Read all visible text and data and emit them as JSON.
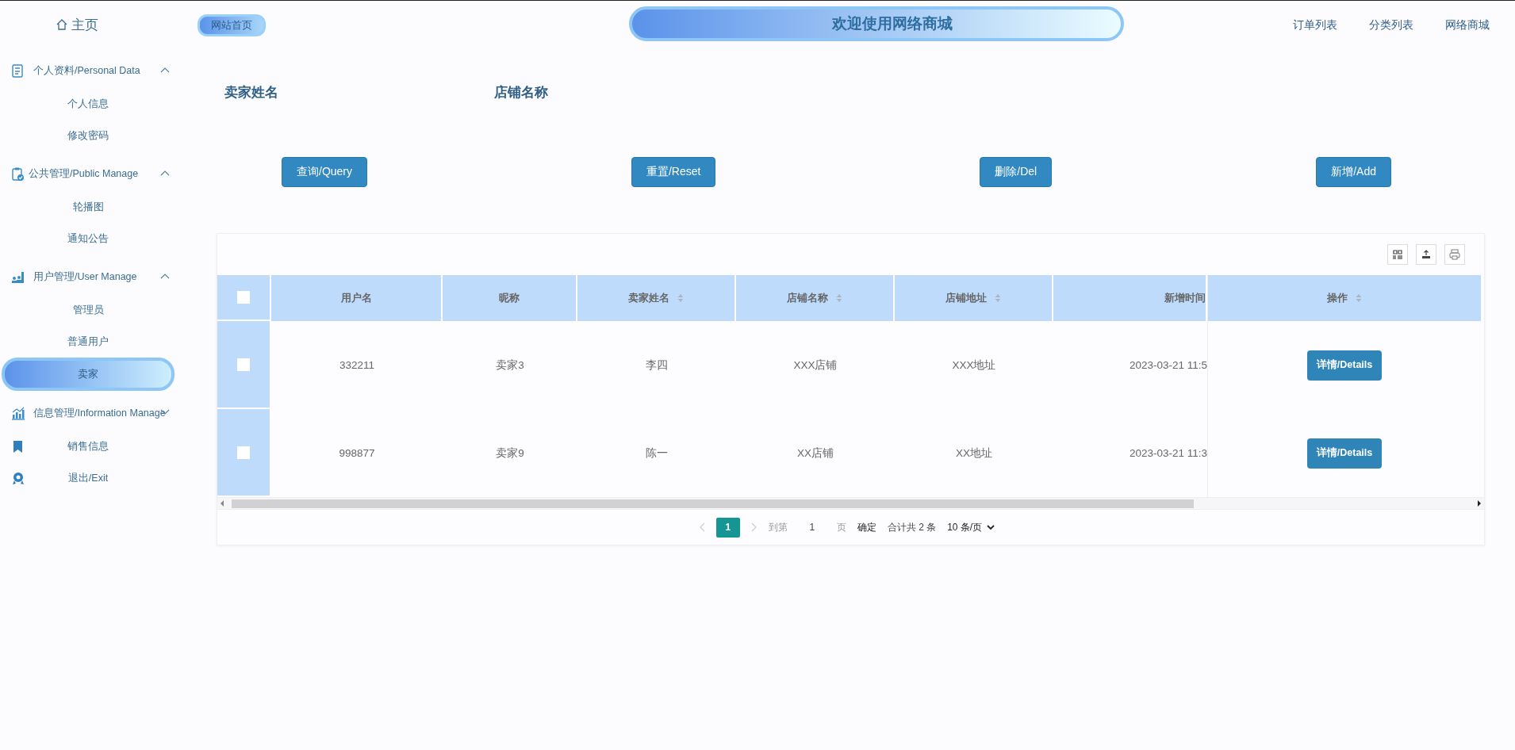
{
  "sidebar": {
    "home": "主页",
    "items": [
      {
        "kind": "group",
        "label": "个人资料/Personal Data",
        "expanded": true,
        "children": [
          {
            "label": "个人信息",
            "selected": false
          },
          {
            "label": "修改密码",
            "selected": false
          }
        ]
      },
      {
        "kind": "group",
        "label": "公共管理/Public Manage",
        "expanded": true,
        "children": [
          {
            "label": "轮播图",
            "selected": false
          },
          {
            "label": "通知公告",
            "selected": false
          }
        ]
      },
      {
        "kind": "group",
        "label": "用户管理/User Manage",
        "expanded": true,
        "children": [
          {
            "label": "管理员",
            "selected": false
          },
          {
            "label": "普通用户",
            "selected": false
          },
          {
            "label": "卖家",
            "selected": true
          }
        ]
      },
      {
        "kind": "group",
        "label": "信息管理/Information Manage",
        "expanded": false
      },
      {
        "kind": "item",
        "label": "销售信息"
      },
      {
        "kind": "item",
        "label": "退出/Exit"
      }
    ]
  },
  "header": {
    "home_link": "网站首页",
    "title": "欢迎使用网络商城",
    "nav": [
      "订单列表",
      "分类列表",
      "网络商城"
    ]
  },
  "search": {
    "fields": [
      "卖家姓名",
      "店铺名称"
    ]
  },
  "buttons": [
    "查询/Query",
    "重置/Reset",
    "删除/Del",
    "新增/Add"
  ],
  "table": {
    "select_all": false,
    "columns": [
      {
        "label": "用户名",
        "sortable": false
      },
      {
        "label": "昵称",
        "sortable": false
      },
      {
        "label": "卖家姓名",
        "sortable": true
      },
      {
        "label": "店铺名称",
        "sortable": true
      },
      {
        "label": "店铺地址",
        "sortable": true
      },
      {
        "label": "新增时间",
        "sortable": false
      },
      {
        "label": "操作",
        "sortable": true
      }
    ],
    "rows": [
      {
        "checked": false,
        "cells": [
          "332211",
          "卖家3",
          "李四",
          "XXX店铺",
          "XXX地址",
          "2023-03-21 11:5"
        ],
        "action": "详情/Details"
      },
      {
        "checked": false,
        "cells": [
          "998877",
          "卖家9",
          "陈一",
          "XX店铺",
          "XX地址",
          "2023-03-21 11:3"
        ],
        "action": "详情/Details"
      }
    ]
  },
  "pagination": {
    "pages": [
      {
        "label": "1",
        "selected": true
      }
    ],
    "goto_label": "到第",
    "goto_value": "1",
    "page_unit": "页",
    "confirm": "确定",
    "total": "合计共 2 条",
    "page_size": "10 条/页"
  }
}
